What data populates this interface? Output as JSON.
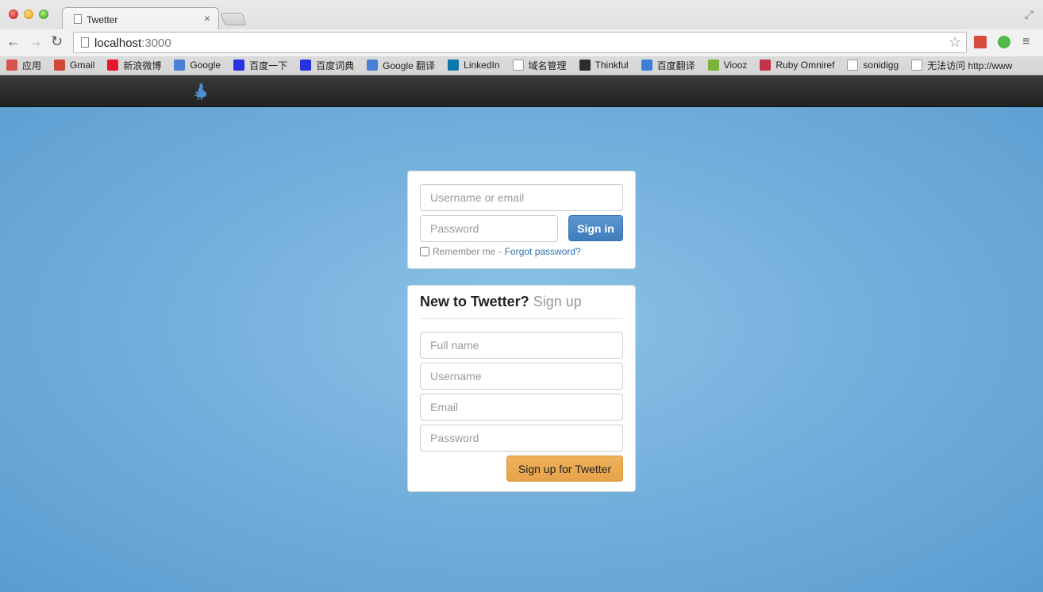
{
  "browser": {
    "tab_title": "Twetter",
    "url_host": "localhost",
    "url_port": ":3000",
    "bookmarks": [
      {
        "label": "应用",
        "icon": "apps-icon",
        "color": "#d9534f"
      },
      {
        "label": "Gmail",
        "icon": "gmail-icon",
        "color": "#d14836"
      },
      {
        "label": "新浪微博",
        "icon": "weibo-icon",
        "color": "#e6162d"
      },
      {
        "label": "Google",
        "icon": "google-icon",
        "color": "#4a7fd6"
      },
      {
        "label": "百度一下",
        "icon": "baidu-icon",
        "color": "#2932e1"
      },
      {
        "label": "百度词典",
        "icon": "baidu-icon",
        "color": "#2932e1"
      },
      {
        "label": "Google 翻译",
        "icon": "google-translate-icon",
        "color": "#4a7fd6"
      },
      {
        "label": "LinkedIn",
        "icon": "linkedin-icon",
        "color": "#0e76a8"
      },
      {
        "label": "域名管理",
        "icon": "page-icon",
        "color": "#ffffff"
      },
      {
        "label": "Thinkful",
        "icon": "thinkful-icon",
        "color": "#2d2d2d"
      },
      {
        "label": "百度翻译",
        "icon": "baidu-translate-icon",
        "color": "#3b7fd8"
      },
      {
        "label": "Viooz",
        "icon": "viooz-icon",
        "color": "#7bb33c"
      },
      {
        "label": "Ruby Omniref",
        "icon": "ruby-icon",
        "color": "#c2334a"
      },
      {
        "label": "sonidigg",
        "icon": "page-icon",
        "color": "#ffffff"
      },
      {
        "label": "无法访问 http://www",
        "icon": "page-icon",
        "color": "#ffffff"
      }
    ]
  },
  "login": {
    "username_placeholder": "Username or email",
    "password_placeholder": "Password",
    "signin_label": "Sign in",
    "remember_label": "Remember me -",
    "forgot_label": "Forgot password?"
  },
  "signup": {
    "heading": "New to Twetter?",
    "subheading": "Sign up",
    "fullname_placeholder": "Full name",
    "username_placeholder": "Username",
    "email_placeholder": "Email",
    "password_placeholder": "Password",
    "submit_label": "Sign up for Twetter"
  },
  "colors": {
    "accent": "#4582c0",
    "warning": "#eaa954",
    "background": "#7ab4df"
  }
}
